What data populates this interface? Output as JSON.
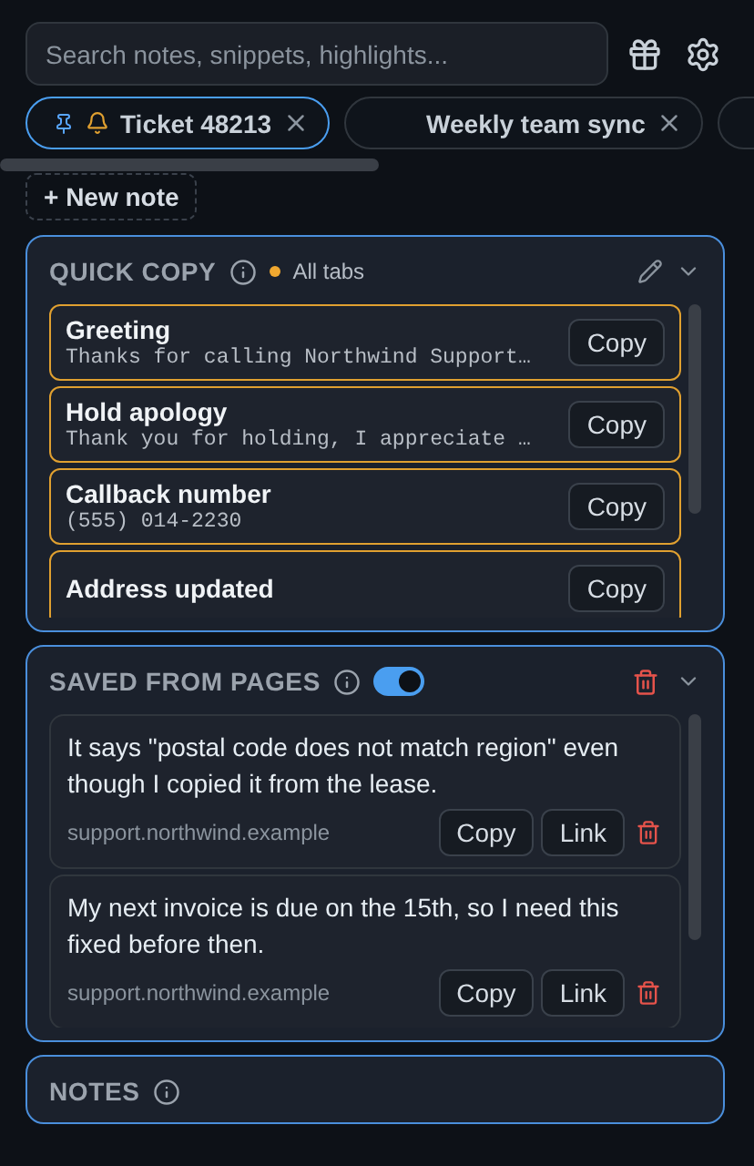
{
  "search": {
    "placeholder": "Search notes, snippets, highlights..."
  },
  "tabs": [
    {
      "label": "Ticket 48213",
      "selected": true,
      "pinned": true,
      "reminder": true
    },
    {
      "label": "Weekly team sync",
      "selected": false
    },
    {
      "selected": false
    }
  ],
  "new_note_button": "+ New note",
  "quick_copy": {
    "title": "QUICK COPY",
    "scope": "All tabs",
    "items": [
      {
        "title": "Greeting",
        "text": "Thanks for calling Northwind Support…",
        "button": "Copy"
      },
      {
        "title": "Hold apology",
        "text": "Thank you for holding, I appreciate …",
        "button": "Copy"
      },
      {
        "title": "Callback number",
        "text": "(555) 014-2230",
        "button": "Copy"
      },
      {
        "title": "Address updated",
        "button": "Copy"
      }
    ]
  },
  "saved": {
    "title": "SAVED FROM PAGES",
    "enabled": true,
    "items": [
      {
        "text": "It says \"postal code does not match region\" even though I copied it from the lease.",
        "source": "support.northwind.example",
        "copy": "Copy",
        "link": "Link"
      },
      {
        "text": "My next invoice is due on the 15th, so I need this fixed before then.",
        "source": "support.northwind.example",
        "copy": "Copy",
        "link": "Link"
      }
    ]
  },
  "notes": {
    "title": "NOTES"
  }
}
